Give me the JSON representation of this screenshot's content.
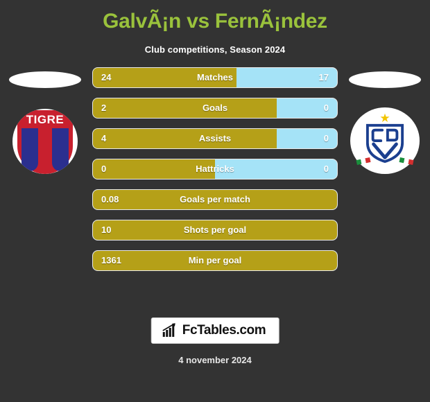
{
  "header": {
    "title": "GalvÃ¡n vs FernÃ¡ndez",
    "subtitle": "Club competitions, Season 2024"
  },
  "teams": {
    "left": {
      "name": "TIGRE",
      "crest": "tigre-crest-icon"
    },
    "right": {
      "name": "",
      "crest": "velez-sarsfield-crest-icon"
    }
  },
  "colors": {
    "background": "#333333",
    "title": "#9ac23c",
    "left_bar": "#b5a018",
    "right_bar": "#a5e3f7",
    "text": "#ffffff"
  },
  "chart_data": {
    "type": "bar",
    "title": "GalvÃ¡n vs FernÃ¡ndez",
    "subtitle": "Club competitions, Season 2024",
    "orientation": "horizontal-diverging",
    "categories": [
      "Matches",
      "Goals",
      "Assists",
      "Hattricks",
      "Goals per match",
      "Shots per goal",
      "Min per goal"
    ],
    "series": [
      {
        "name": "GalvÃ¡n",
        "values": [
          "24",
          "2",
          "4",
          "0",
          "0.08",
          "10",
          "1361"
        ]
      },
      {
        "name": "FernÃ¡ndez",
        "values": [
          "17",
          "0",
          "0",
          "0",
          null,
          null,
          null
        ]
      }
    ],
    "left_share_pct": [
      58.7,
      75.4,
      75.4,
      50,
      100,
      100,
      100
    ],
    "legend": [
      "GalvÃ¡n",
      "FernÃ¡ndez"
    ],
    "xlabel": "",
    "ylabel": ""
  },
  "rows": [
    {
      "label": "Matches",
      "left": "24",
      "right": "17",
      "fill": 58.7,
      "full": false
    },
    {
      "label": "Goals",
      "left": "2",
      "right": "0",
      "fill": 75.4,
      "full": false
    },
    {
      "label": "Assists",
      "left": "4",
      "right": "0",
      "fill": 75.4,
      "full": false
    },
    {
      "label": "Hattricks",
      "left": "0",
      "right": "0",
      "fill": 50.0,
      "full": false
    },
    {
      "label": "Goals per match",
      "left": "0.08",
      "right": "",
      "fill": 100.0,
      "full": true
    },
    {
      "label": "Shots per goal",
      "left": "10",
      "right": "",
      "fill": 100.0,
      "full": true
    },
    {
      "label": "Min per goal",
      "left": "1361",
      "right": "",
      "fill": 100.0,
      "full": true
    }
  ],
  "footer": {
    "brand": "FcTables.com",
    "brand_icon": "bar-chart-arrow-icon",
    "date": "4 november 2024"
  }
}
